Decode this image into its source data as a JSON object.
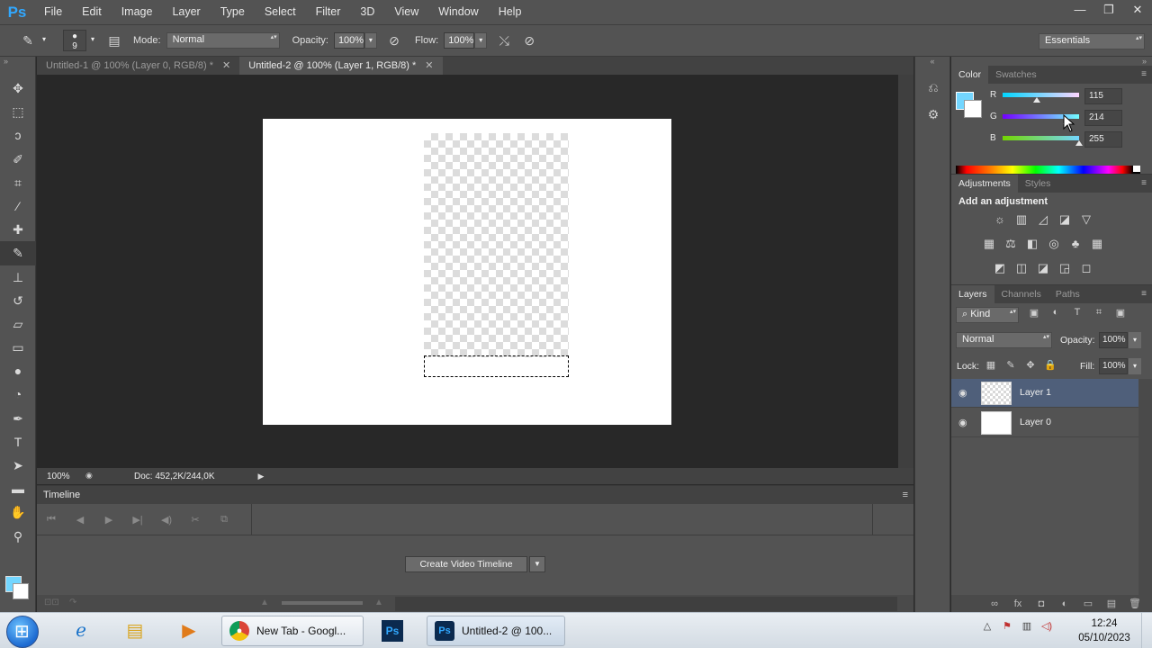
{
  "app": {
    "logo": "Ps"
  },
  "menu": [
    "File",
    "Edit",
    "Image",
    "Layer",
    "Type",
    "Select",
    "Filter",
    "3D",
    "View",
    "Window",
    "Help"
  ],
  "window_controls": {
    "minimize": "—",
    "restore": "❐",
    "close": "✕"
  },
  "options_bar": {
    "brush_size": "9",
    "mode_label": "Mode:",
    "mode_value": "Normal",
    "opacity_label": "Opacity:",
    "opacity_value": "100%",
    "flow_label": "Flow:",
    "flow_value": "100%",
    "workspace": "Essentials"
  },
  "tools": [
    "move-icon",
    "marquee-icon",
    "lasso-icon",
    "quick-select-icon",
    "crop-icon",
    "eyedropper-icon",
    "healing-icon",
    "brush-icon",
    "clone-stamp-icon",
    "history-brush-icon",
    "eraser-icon",
    "gradient-icon",
    "blur-icon",
    "dodge-icon",
    "pen-icon",
    "type-icon",
    "path-select-icon",
    "rectangle-icon",
    "hand-icon",
    "zoom-icon"
  ],
  "active_tool": "brush-icon",
  "foreground_color": "#73d6ff",
  "background_color": "#ffffff",
  "doc_tabs": [
    {
      "label": "Untitled-1 @ 100% (Layer 0, RGB/8) *",
      "close": "✕",
      "active": false
    },
    {
      "label": "Untitled-2 @ 100% (Layer 1, RGB/8) *",
      "close": "✕",
      "active": true
    }
  ],
  "status": {
    "zoom": "100%",
    "doc_size": "Doc: 452,2K/244,0K",
    "arrow": "▶"
  },
  "timeline": {
    "title": "Timeline",
    "menu": "≡",
    "controls": [
      "⏮",
      "◀",
      "▶",
      "▶|",
      "◀)",
      "✂",
      "⧉"
    ],
    "create_button": "Create Video Timeline",
    "create_arrow": "▼"
  },
  "color_panel": {
    "tabs": [
      "Color",
      "Swatches"
    ],
    "active_tab": "Color",
    "menu": "≡",
    "r": {
      "label": "R",
      "value": "115",
      "fraction": 0.451
    },
    "g": {
      "label": "G",
      "value": "214",
      "fraction": 0.839
    },
    "b": {
      "label": "B",
      "value": "255",
      "fraction": 1.0
    }
  },
  "adjustments_panel": {
    "tabs": [
      "Adjustments",
      "Styles"
    ],
    "active_tab": "Adjustments",
    "title": "Add an adjustment",
    "icons_row1": [
      "☼",
      "▥",
      "◿",
      "◪",
      "▽"
    ],
    "icons_row2": [
      "▦",
      "⚖",
      "◧",
      "◎",
      "♣",
      "▦"
    ],
    "icons_row3": [
      "◩",
      "◫",
      "◪",
      "◲",
      "◻"
    ]
  },
  "layers_panel": {
    "tabs": [
      "Layers",
      "Channels",
      "Paths"
    ],
    "active_tab": "Layers",
    "filter_label": "⌕ Kind",
    "filter_icons": [
      "▣",
      "◐",
      "T",
      "⌗",
      "▣"
    ],
    "blend_mode": "Normal",
    "opacity_label": "Opacity:",
    "opacity_value": "100%",
    "lock_label": "Lock:",
    "lock_icons": [
      "▦",
      "✎",
      "✥",
      "🔒"
    ],
    "fill_label": "Fill:",
    "fill_value": "100%",
    "layers": [
      {
        "name": "Layer 1",
        "selected": true
      },
      {
        "name": "Layer 0",
        "selected": false
      }
    ],
    "footer_icons": [
      "∞",
      "fx",
      "◘",
      "◐",
      "▭",
      "▤",
      "🗑"
    ]
  },
  "taskbar": {
    "apps": [
      {
        "label": "New Tab - Googl...",
        "icon": "chrome-icon"
      },
      {
        "label": "Untitled-2 @ 100...",
        "icon": "photoshop-icon"
      }
    ],
    "ps_icon_text": "Ps",
    "time": "12:24",
    "date": "05/10/2023"
  }
}
